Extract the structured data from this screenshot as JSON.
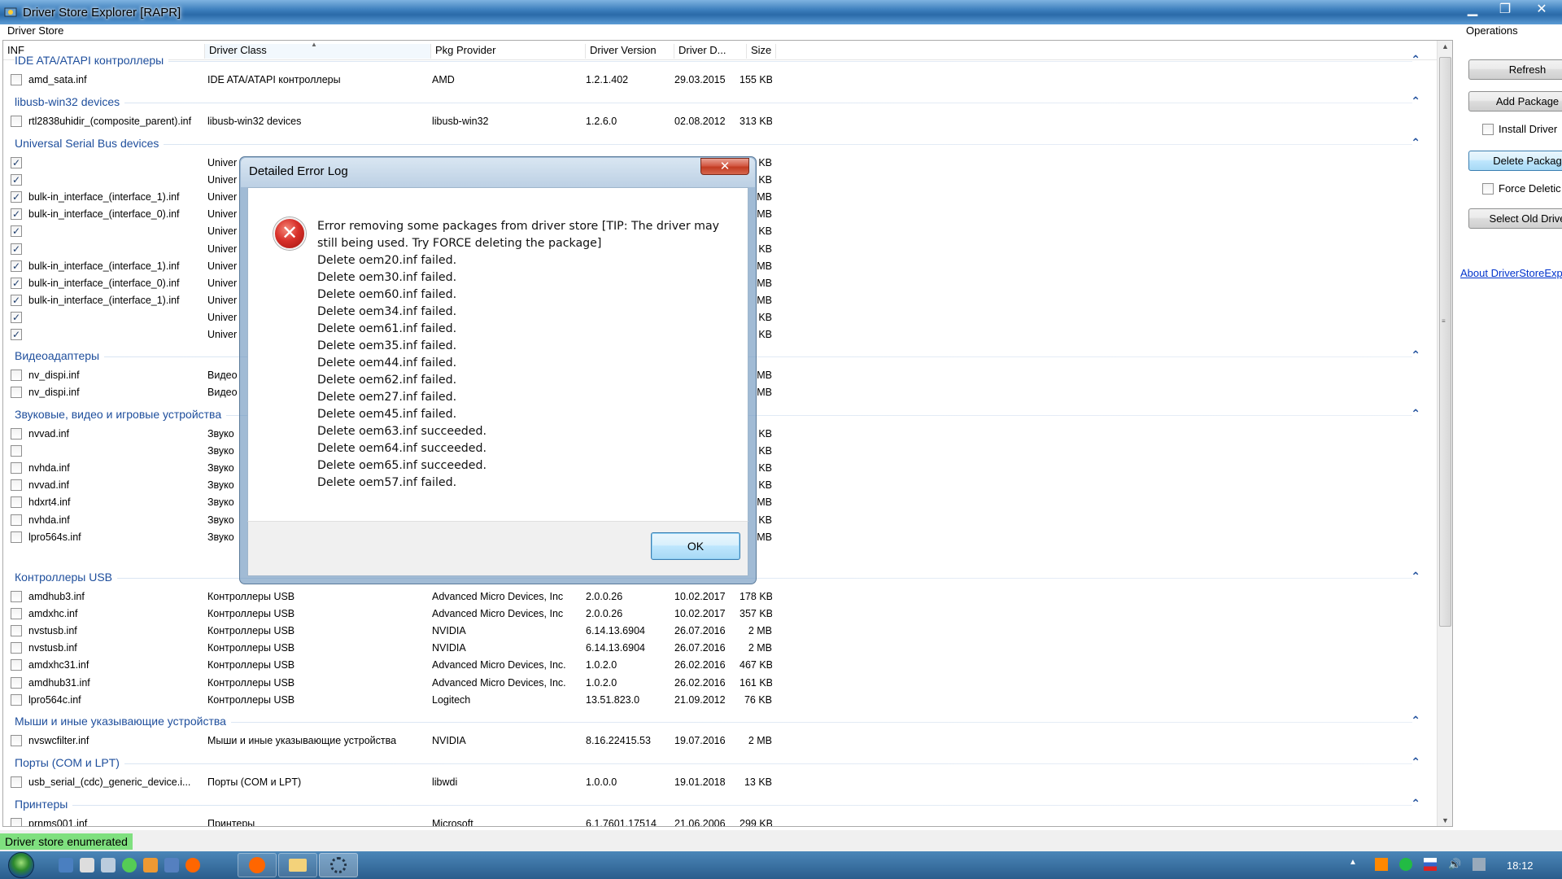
{
  "window": {
    "title": "Driver Store Explorer [RAPR]",
    "minimize": "▁",
    "maximize": "❐",
    "close": "✕"
  },
  "labels": {
    "driver_store": "Driver Store",
    "operations": "Operations"
  },
  "columns": {
    "inf": "INF",
    "driver_class": "Driver Class",
    "pkg_provider": "Pkg Provider",
    "driver_version": "Driver Version",
    "driver_date": "Driver D...",
    "size": "Size"
  },
  "groups": [
    {
      "title": "IDE ATA/ATAPI контроллеры"
    },
    {
      "title": "libusb-win32 devices"
    },
    {
      "title": "Universal Serial Bus devices"
    },
    {
      "title": "Видеоадаптеры"
    },
    {
      "title": "Звуковые, видео и игровые устройства"
    },
    {
      "title": "Контроллеры USB"
    },
    {
      "title": "Мыши и иные указывающие устройства"
    },
    {
      "title": "Порты (COM и LPT)"
    },
    {
      "title": "Принтеры"
    }
  ],
  "rows": [
    {
      "inf": "amd_sata.inf",
      "cls": "IDE ATA/ATAPI контроллеры",
      "prov": "AMD",
      "ver": "1.2.1.402",
      "date": "29.03.2015",
      "size": "155 KB",
      "checked": ""
    },
    {
      "inf": "rtl2838uhidir_(composite_parent).inf",
      "cls": "libusb-win32 devices",
      "prov": "libusb-win32",
      "ver": "1.2.6.0",
      "date": "02.08.2012",
      "size": "313 KB",
      "checked": ""
    },
    {
      "inf": "",
      "cls": "Univer",
      "prov": "",
      "ver": "",
      "date": "",
      "size": "KB",
      "checked": "✓"
    },
    {
      "inf": "",
      "cls": "Univer",
      "prov": "",
      "ver": "",
      "date": "",
      "size": "KB",
      "checked": "✓"
    },
    {
      "inf": "bulk-in_interface_(interface_1).inf",
      "cls": "Univer",
      "prov": "",
      "ver": "",
      "date": "",
      "size": "MB",
      "checked": "✓"
    },
    {
      "inf": "bulk-in_interface_(interface_0).inf",
      "cls": "Univer",
      "prov": "",
      "ver": "",
      "date": "",
      "size": "MB",
      "checked": "✓"
    },
    {
      "inf": "",
      "cls": "Univer",
      "prov": "",
      "ver": "",
      "date": "",
      "size": "KB",
      "checked": "✓"
    },
    {
      "inf": "",
      "cls": "Univer",
      "prov": "",
      "ver": "",
      "date": "",
      "size": "KB",
      "checked": "✓"
    },
    {
      "inf": "bulk-in_interface_(interface_1).inf",
      "cls": "Univer",
      "prov": "",
      "ver": "",
      "date": "",
      "size": "MB",
      "checked": "✓"
    },
    {
      "inf": "bulk-in_interface_(interface_0).inf",
      "cls": "Univer",
      "prov": "",
      "ver": "",
      "date": "",
      "size": "MB",
      "checked": "✓"
    },
    {
      "inf": "bulk-in_interface_(interface_1).inf",
      "cls": "Univer",
      "prov": "",
      "ver": "",
      "date": "",
      "size": "MB",
      "checked": "✓"
    },
    {
      "inf": "",
      "cls": "Univer",
      "prov": "",
      "ver": "",
      "date": "",
      "size": "KB",
      "checked": "✓"
    },
    {
      "inf": "",
      "cls": "Univer",
      "prov": "",
      "ver": "",
      "date": "",
      "size": "KB",
      "checked": "✓"
    },
    {
      "inf": "nv_dispi.inf",
      "cls": "Видео",
      "prov": "",
      "ver": "",
      "date": "",
      "size": "MB",
      "checked": ""
    },
    {
      "inf": "nv_dispi.inf",
      "cls": "Видео",
      "prov": "",
      "ver": "",
      "date": "",
      "size": "MB",
      "checked": ""
    },
    {
      "inf": "nvvad.inf",
      "cls": "Звуко",
      "prov": "",
      "ver": "",
      "date": "",
      "size": "KB",
      "checked": ""
    },
    {
      "inf": "",
      "cls": "Звуко",
      "prov": "",
      "ver": "",
      "date": "",
      "size": "KB",
      "checked": ""
    },
    {
      "inf": "nvhda.inf",
      "cls": "Звуко",
      "prov": "",
      "ver": "",
      "date": "",
      "size": "KB",
      "checked": ""
    },
    {
      "inf": "nvvad.inf",
      "cls": "Звуко",
      "prov": "",
      "ver": "",
      "date": "",
      "size": "KB",
      "checked": ""
    },
    {
      "inf": "hdxrt4.inf",
      "cls": "Звуко",
      "prov": "",
      "ver": "",
      "date": "",
      "size": "MB",
      "checked": ""
    },
    {
      "inf": "nvhda.inf",
      "cls": "Звуко",
      "prov": "",
      "ver": "",
      "date": "",
      "size": "KB",
      "checked": ""
    },
    {
      "inf": "lpro564s.inf",
      "cls": "Звуко",
      "prov": "",
      "ver": "",
      "date": "",
      "size": "MB",
      "checked": ""
    },
    {
      "inf": "amdhub3.inf",
      "cls": "Контроллеры USB",
      "prov": "Advanced Micro Devices, Inc",
      "ver": "2.0.0.26",
      "date": "10.02.2017",
      "size": "178 KB",
      "checked": ""
    },
    {
      "inf": "amdxhc.inf",
      "cls": "Контроллеры USB",
      "prov": "Advanced Micro Devices, Inc",
      "ver": "2.0.0.26",
      "date": "10.02.2017",
      "size": "357 KB",
      "checked": ""
    },
    {
      "inf": "nvstusb.inf",
      "cls": "Контроллеры USB",
      "prov": "NVIDIA",
      "ver": "6.14.13.6904",
      "date": "26.07.2016",
      "size": "2 MB",
      "checked": ""
    },
    {
      "inf": "nvstusb.inf",
      "cls": "Контроллеры USB",
      "prov": "NVIDIA",
      "ver": "6.14.13.6904",
      "date": "26.07.2016",
      "size": "2 MB",
      "checked": ""
    },
    {
      "inf": "amdxhc31.inf",
      "cls": "Контроллеры USB",
      "prov": "Advanced Micro Devices, Inc.",
      "ver": "1.0.2.0",
      "date": "26.02.2016",
      "size": "467 KB",
      "checked": ""
    },
    {
      "inf": "amdhub31.inf",
      "cls": "Контроллеры USB",
      "prov": "Advanced Micro Devices, Inc.",
      "ver": "1.0.2.0",
      "date": "26.02.2016",
      "size": "161 KB",
      "checked": ""
    },
    {
      "inf": "lpro564c.inf",
      "cls": "Контроллеры USB",
      "prov": "Logitech",
      "ver": "13.51.823.0",
      "date": "21.09.2012",
      "size": "76 KB",
      "checked": ""
    },
    {
      "inf": "nvswcfilter.inf",
      "cls": "Мыши и иные указывающие устройства",
      "prov": "NVIDIA",
      "ver": "8.16.22415.53",
      "date": "19.07.2016",
      "size": "2 MB",
      "checked": ""
    },
    {
      "inf": "usb_serial_(cdc)_generic_device.i...",
      "cls": "Порты (COM и LPT)",
      "prov": "libwdi",
      "ver": "1.0.0.0",
      "date": "19.01.2018",
      "size": "13 KB",
      "checked": ""
    },
    {
      "inf": "prnms001.inf",
      "cls": "Принтеры",
      "prov": "Microsoft",
      "ver": "6.1.7601.17514",
      "date": "21.06.2006",
      "size": "299 KB",
      "checked": ""
    }
  ],
  "operations": {
    "refresh": "Refresh",
    "add_package": "Add Package",
    "install_driver": "Install Driver",
    "delete_package": "Delete Packag",
    "force_deletion": "Force Deletic",
    "select_old_drivers": "Select Old Drive",
    "about": "About DriverStoreExp"
  },
  "status": {
    "text": "Driver store enumerated"
  },
  "dialog": {
    "title": "Detailed Error Log",
    "close": "✕",
    "icon": "✕",
    "lines": [
      "Error removing some packages from driver store [TIP: The driver may",
      "still being used. Try FORCE deleting the package]",
      "Delete oem20.inf failed.",
      "Delete oem30.inf failed.",
      "Delete oem60.inf failed.",
      "Delete oem34.inf failed.",
      "Delete oem61.inf failed.",
      "Delete oem35.inf failed.",
      "Delete oem44.inf failed.",
      "Delete oem62.inf failed.",
      "Delete oem27.inf failed.",
      "Delete oem45.inf failed.",
      "Delete oem63.inf succeeded.",
      "Delete oem64.inf succeeded.",
      "Delete oem65.inf succeeded.",
      "Delete oem57.inf failed."
    ],
    "ok": "OK"
  },
  "taskbar": {
    "clock": "18:12"
  },
  "colors": {
    "group_title": "#1e4e9c",
    "status_green": "#7fe07f",
    "error_red": "#d8302a"
  },
  "icons": [
    "app-icon",
    "start-orb",
    "error-icon",
    "chevron-up-icon",
    "checkbox-icon"
  ]
}
